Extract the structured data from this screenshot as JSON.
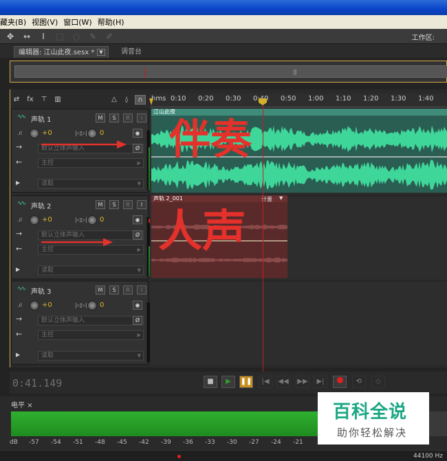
{
  "menu": [
    "藏夹(B)",
    "视图(V)",
    "窗口(W)",
    "帮助(H)"
  ],
  "toolbar": {
    "workspace_label": "工作区:"
  },
  "tabs": {
    "editor": "编辑器: 江山此夜.sesx *",
    "mixer": "调音台"
  },
  "ruler": {
    "unit": "hms",
    "labels": [
      "0:10",
      "0:20",
      "0:30",
      "0:40",
      "0:50",
      "1:00",
      "1:10",
      "1:20",
      "1:30",
      "1:40"
    ]
  },
  "tracks": [
    {
      "name": "声轨 1",
      "pan": "+0",
      "vol": "0",
      "input": "默认立体声输入",
      "output": "主控",
      "automation": "读取",
      "clip": "江山此夜",
      "handwriting": "伴奏"
    },
    {
      "name": "声轨 2",
      "pan": "+0",
      "vol": "0",
      "input": "默认立体声输入",
      "output": "主控",
      "automation": "读取",
      "clip": "声轨 2_001",
      "clip_right": "计量",
      "handwriting": "人声"
    },
    {
      "name": "声轨 3",
      "pan": "+0",
      "vol": "0",
      "input": "默认立体声输入",
      "output": "主控",
      "automation": "读取"
    }
  ],
  "buttons": {
    "m": "M",
    "s": "S",
    "r": "R",
    "i": "I"
  },
  "transport": {
    "timecode": "0:41.149"
  },
  "levels": {
    "tab": "电平",
    "db": [
      "dB",
      "-57",
      "-54",
      "-51",
      "-48",
      "-45",
      "-42",
      "-39",
      "-36",
      "-33",
      "-30",
      "-27",
      "-24",
      "-21"
    ]
  },
  "status": {
    "samplerate": "44100 Hz"
  },
  "watermark": {
    "title": "百科全说",
    "subtitle": "助你轻松解决"
  },
  "colors": {
    "wave": "#3fd69a",
    "clip1_bg": "#2a5e52",
    "clip2_bg": "#5a2a2a",
    "playhead": "#c02020",
    "accent": "#d4a84b"
  }
}
